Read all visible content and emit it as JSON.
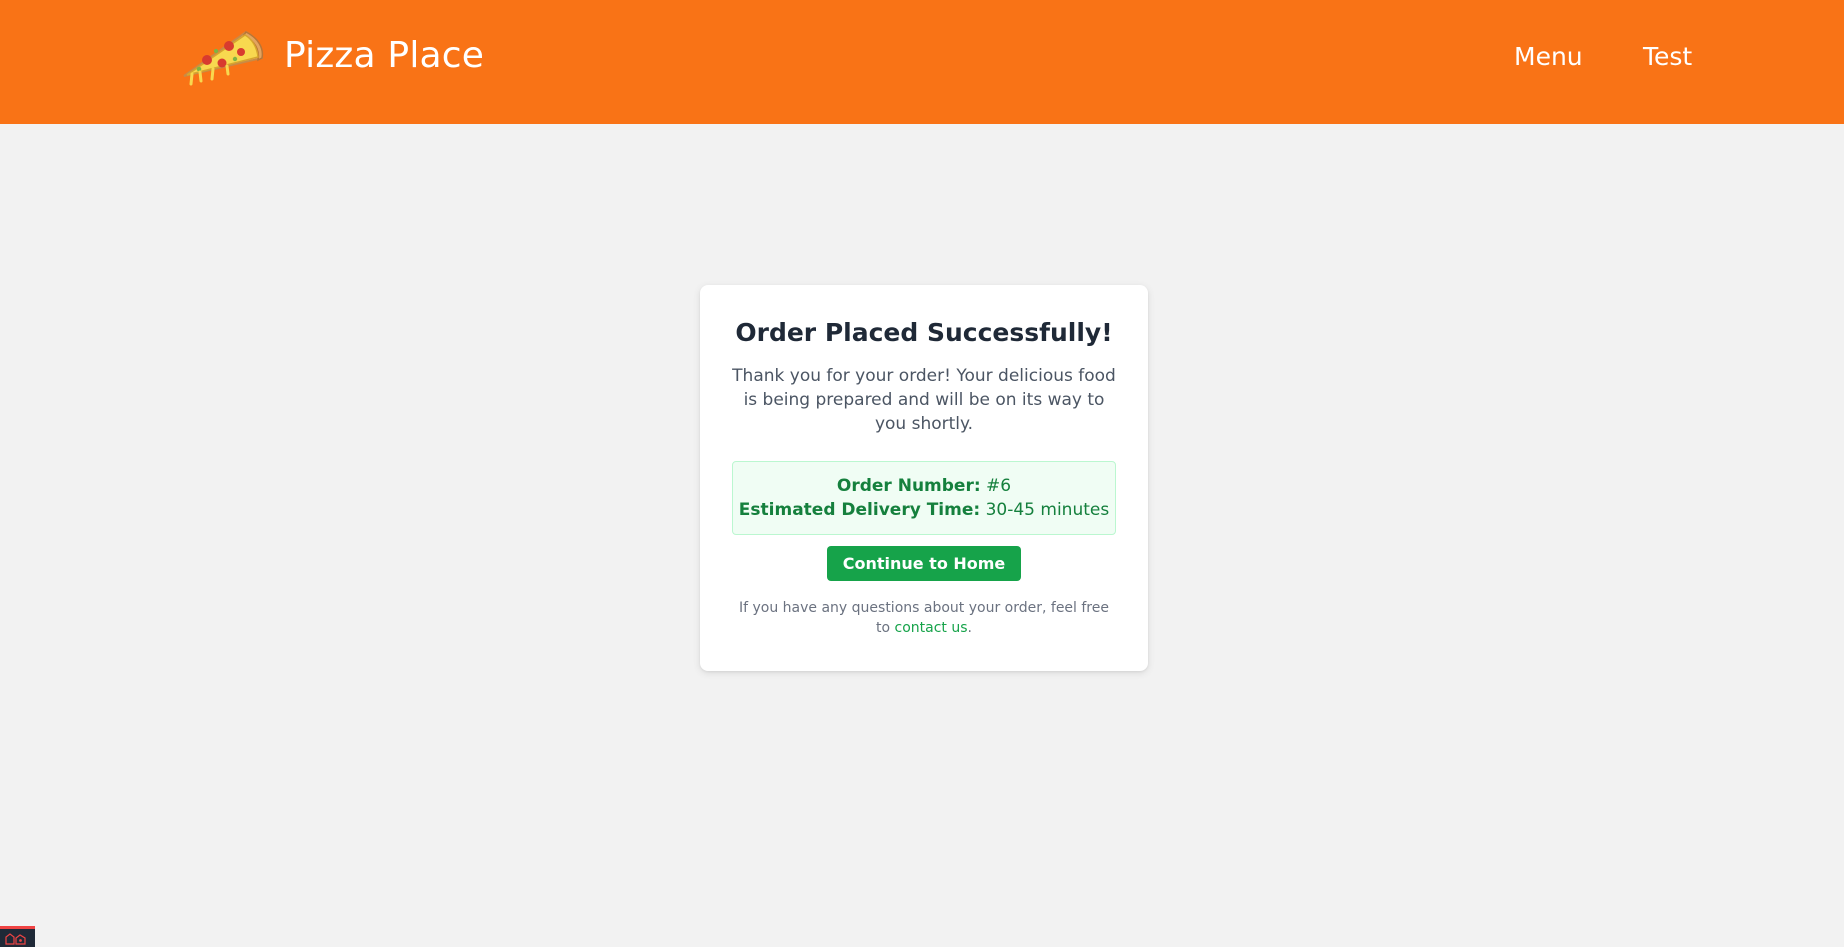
{
  "header": {
    "brand_name": "Pizza Place",
    "logo_icon": "pizza-slice-icon",
    "nav": [
      {
        "label": "Menu"
      },
      {
        "label": "Test"
      }
    ],
    "background_color": "#f97316"
  },
  "confirmation": {
    "title": "Order Placed Successfully!",
    "message": "Thank you for your order! Your delicious food is being prepared and will be on its way to you shortly.",
    "order_number_label": "Order Number:",
    "order_number_value": "#6",
    "delivery_time_label": "Estimated Delivery Time:",
    "delivery_time_value": "30-45 minutes",
    "continue_button": "Continue to Home",
    "help_text_prefix": "If you have any questions about your order, feel free to",
    "contact_link": "contact us",
    "help_text_suffix": ".",
    "accent_color": "#16a34a"
  },
  "corner_widget": {
    "icon": "devtools-icon"
  }
}
